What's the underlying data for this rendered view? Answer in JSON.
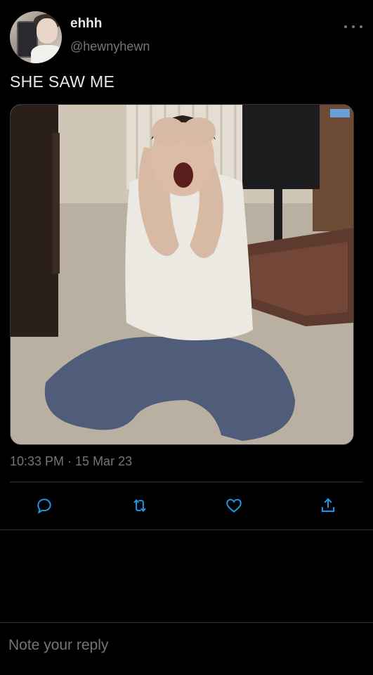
{
  "author": {
    "display_name": "ehhh",
    "handle": "@hewnyhewn"
  },
  "tweet": {
    "text": "SHE SAW ME",
    "timestamp": "10:33 PM · 15 Mar 23"
  },
  "actions": {
    "icons": [
      "reply-icon",
      "retweet-icon",
      "like-icon",
      "share-icon"
    ]
  },
  "composer": {
    "placeholder": "Note your reply"
  },
  "colors": {
    "background": "#000000",
    "text": "#e7e9ea",
    "secondary": "#71767b",
    "divider": "#2f3336"
  }
}
